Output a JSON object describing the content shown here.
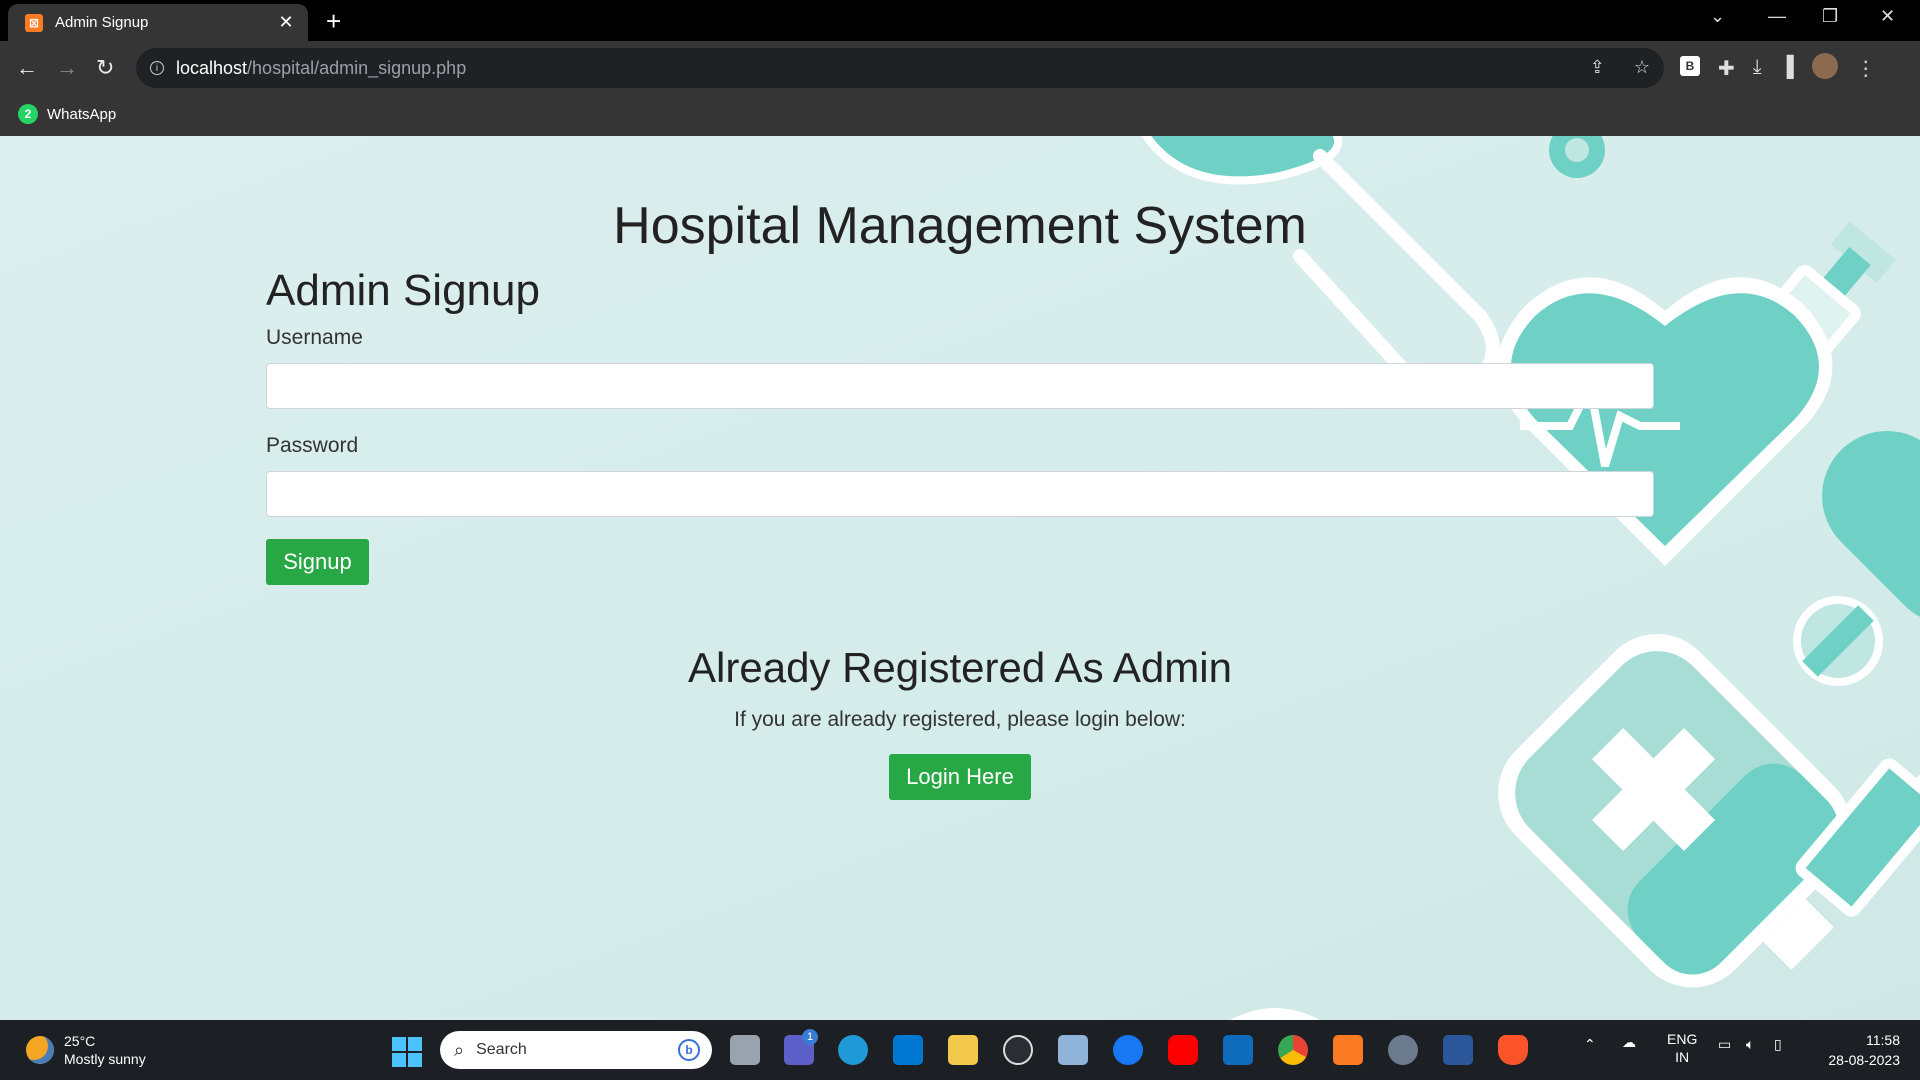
{
  "browser": {
    "tab_title": "Admin Signup",
    "tab_close": "✕",
    "new_tab": "+",
    "url_host": "localhost",
    "url_path": "/hospital/admin_signup.php",
    "bookmark_whatsapp": "WhatsApp",
    "whatsapp_badge": "2"
  },
  "page": {
    "main_title": "Hospital Management System",
    "sub_title": "Admin Signup",
    "username_label": "Username",
    "username_value": "",
    "password_label": "Password",
    "password_value": "",
    "signup_button": "Signup",
    "already_title": "Already Registered As Admin",
    "already_text": "If you are already registered, please login below:",
    "login_button": "Login Here",
    "accent_color": "#28a745",
    "decor_color": "#6fd1c6"
  },
  "taskbar": {
    "weather_temp": "25°C",
    "weather_condition": "Mostly sunny",
    "search_placeholder": "Search",
    "lang_top": "ENG",
    "lang_bottom": "IN",
    "time": "11:58",
    "date": "28-08-2023",
    "teams_badge": "1"
  }
}
